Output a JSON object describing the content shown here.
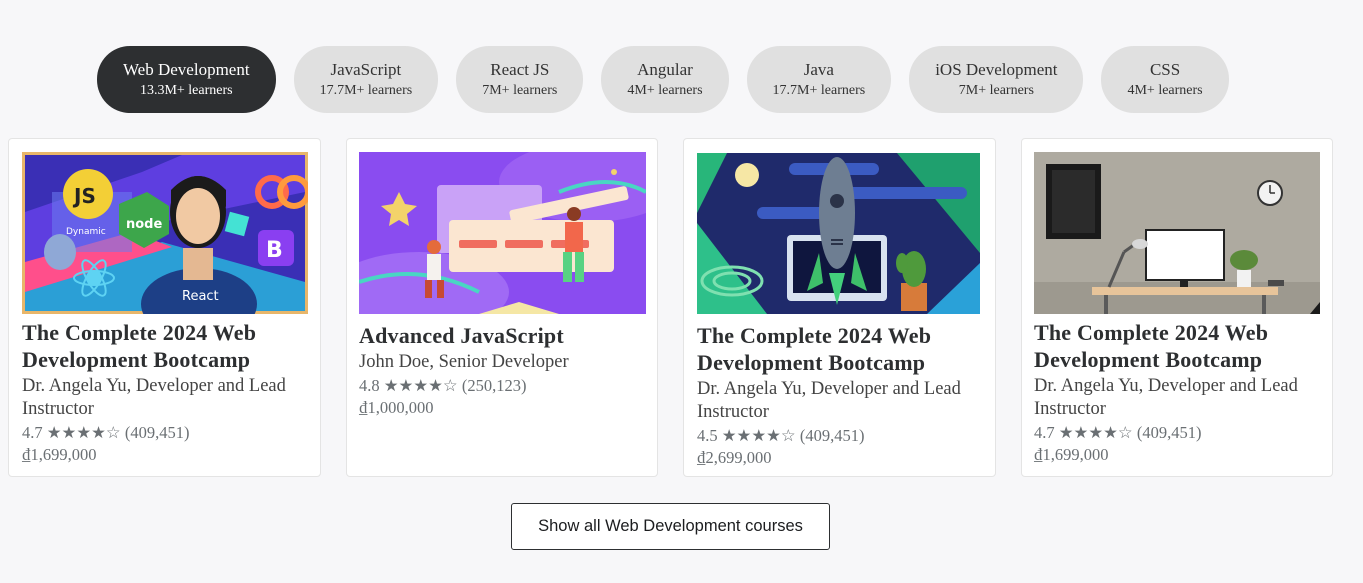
{
  "topics": [
    {
      "name": "Web Development",
      "learners": "13.3M+ learners",
      "active": true
    },
    {
      "name": "JavaScript",
      "learners": "17.7M+ learners"
    },
    {
      "name": "React JS",
      "learners": "7M+ learners"
    },
    {
      "name": "Angular",
      "learners": "4M+ learners"
    },
    {
      "name": "Java",
      "learners": "17.7M+ learners"
    },
    {
      "name": "iOS Development",
      "learners": "7M+ learners"
    },
    {
      "name": "CSS",
      "learners": "4M+ learners"
    }
  ],
  "courses": [
    {
      "title": "The Complete 2024 Web Development Bootcamp",
      "instructor": "Dr. Angela Yu, Developer and Lead Instructor",
      "rating_line": "4.7 ★★★★☆ (409,451)",
      "price": "₫1,699,000",
      "thumb_text": {
        "js": "JS",
        "node": "node",
        "react": "React",
        "b": "B",
        "dynamic": "Dynamic"
      }
    },
    {
      "title": "Advanced JavaScript",
      "instructor": "John Doe, Senior Developer",
      "rating_line": "4.8 ★★★★☆ (250,123)",
      "price": "₫1,000,000"
    },
    {
      "title": "The Complete 2024 Web Development Bootcamp",
      "instructor": "Dr. Angela Yu, Developer and Lead Instructor",
      "rating_line": "4.5 ★★★★☆ (409,451)",
      "price": "₫2,699,000"
    },
    {
      "title": "The Complete 2024 Web Development Bootcamp",
      "instructor": "Dr. Angela Yu, Developer and Lead Instructor",
      "rating_line": "4.7 ★★★★☆ (409,451)",
      "price": "₫1,699,000"
    }
  ],
  "show_all_label": "Show all Web Development courses"
}
